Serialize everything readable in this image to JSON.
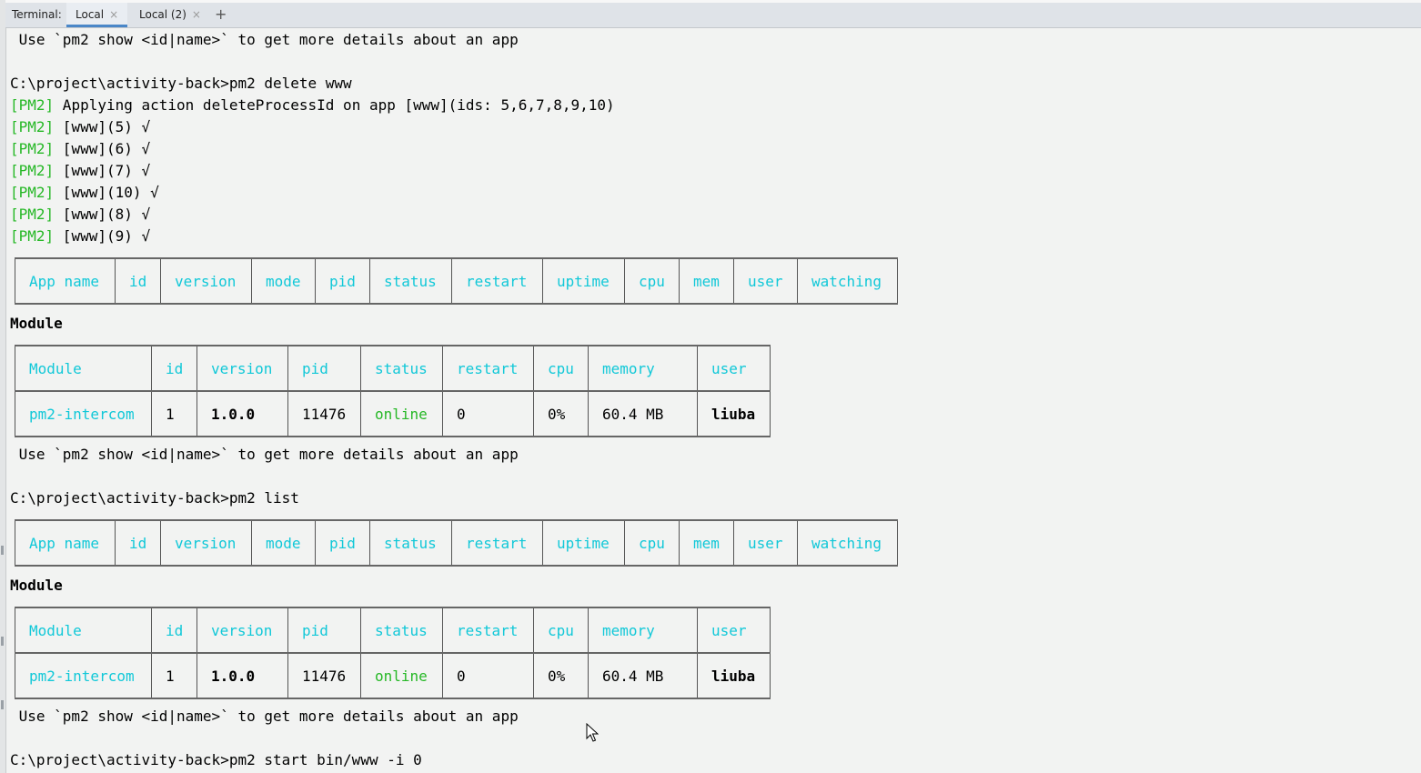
{
  "tabbar": {
    "label": "Terminal:",
    "tabs": [
      {
        "label": "Local",
        "close": "×"
      },
      {
        "label": "Local (2)",
        "close": "×"
      }
    ],
    "add": "+"
  },
  "lines": {
    "l1": " Use `pm2 show <id|name>` to get more details about an app",
    "l2": "C:\\project\\activity-back>pm2 delete www",
    "l3_tag": "[PM2]",
    "l3_text": " Applying action deleteProcessId on app [www](ids: 5,6,7,8,9,10)",
    "pm_lines": [
      {
        "tag": "[PM2]",
        "text": " [www](5) √"
      },
      {
        "tag": "[PM2]",
        "text": " [www](6) √"
      },
      {
        "tag": "[PM2]",
        "text": " [www](7) √"
      },
      {
        "tag": "[PM2]",
        "text": " [www](10) √"
      },
      {
        "tag": "[PM2]",
        "text": " [www](8) √"
      },
      {
        "tag": "[PM2]",
        "text": " [www](9) √"
      }
    ],
    "module_heading": "Module",
    "use_hint": " Use `pm2 show <id|name>` to get more details about an app",
    "cmd_list": "C:\\project\\activity-back>pm2 list",
    "cmd_start": "C:\\project\\activity-back>pm2 start bin/www -i 0"
  },
  "app_table": {
    "headers": [
      "App name",
      "id",
      "version",
      "mode",
      "pid",
      "status",
      "restart",
      "uptime",
      "cpu",
      "mem",
      "user",
      "watching"
    ]
  },
  "module_table": {
    "headers": [
      "Module",
      "id",
      "version",
      "pid",
      "status",
      "restart",
      "cpu",
      "memory",
      "user"
    ],
    "row": [
      "pm2-intercom",
      "1",
      "1.0.0",
      "11476",
      "online",
      "0",
      "0%",
      "60.4 MB",
      "liuba"
    ]
  },
  "colors": {
    "background": "#f2f3f2",
    "pm2_tag": "#26b826",
    "header_cyan": "#11c8d8",
    "online": "#26b826"
  }
}
